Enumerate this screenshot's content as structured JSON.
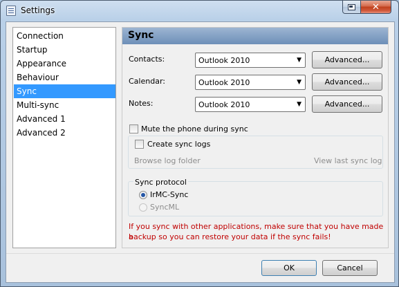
{
  "window": {
    "title": "Settings",
    "close_glyph": "✕"
  },
  "nav": {
    "items": [
      "Connection",
      "Startup",
      "Appearance",
      "Behaviour",
      "Sync",
      "Multi-sync",
      "Advanced 1",
      "Advanced 2"
    ],
    "selected_index": 4
  },
  "panel": {
    "title": "Sync",
    "contacts": {
      "label": "Contacts:",
      "value": "Outlook 2010",
      "button": "Advanced..."
    },
    "calendar": {
      "label": "Calendar:",
      "value": "Outlook 2010",
      "button": "Advanced..."
    },
    "notes": {
      "label": "Notes:",
      "value": "Outlook 2010",
      "button": "Advanced..."
    },
    "mute_label": "Mute the phone during sync",
    "mute_checked": false,
    "create_logs_label": "Create sync logs",
    "create_logs_checked": false,
    "browse_log_folder": "Browse log folder",
    "view_last_log": "View last sync log",
    "protocol": {
      "title": "Sync protocol",
      "options": [
        "IrMC-Sync",
        "SyncML"
      ],
      "selected": "IrMC-Sync"
    },
    "warning_line1": "If you sync with other applications, make sure that you have made a",
    "warning_line2": "backup so you can restore your data if the sync fails!"
  },
  "footer": {
    "ok": "OK",
    "cancel": "Cancel"
  },
  "colors": {
    "selection": "#3399ff",
    "header_top": "#9db5d2",
    "header_bottom": "#6d8fb8",
    "warning": "#c00000",
    "close_button": "#c0411c"
  },
  "icons": {
    "app": "settings-list-icon",
    "dropdown": "chevron-down-icon",
    "help": "help-window-icon",
    "close": "close-icon"
  }
}
